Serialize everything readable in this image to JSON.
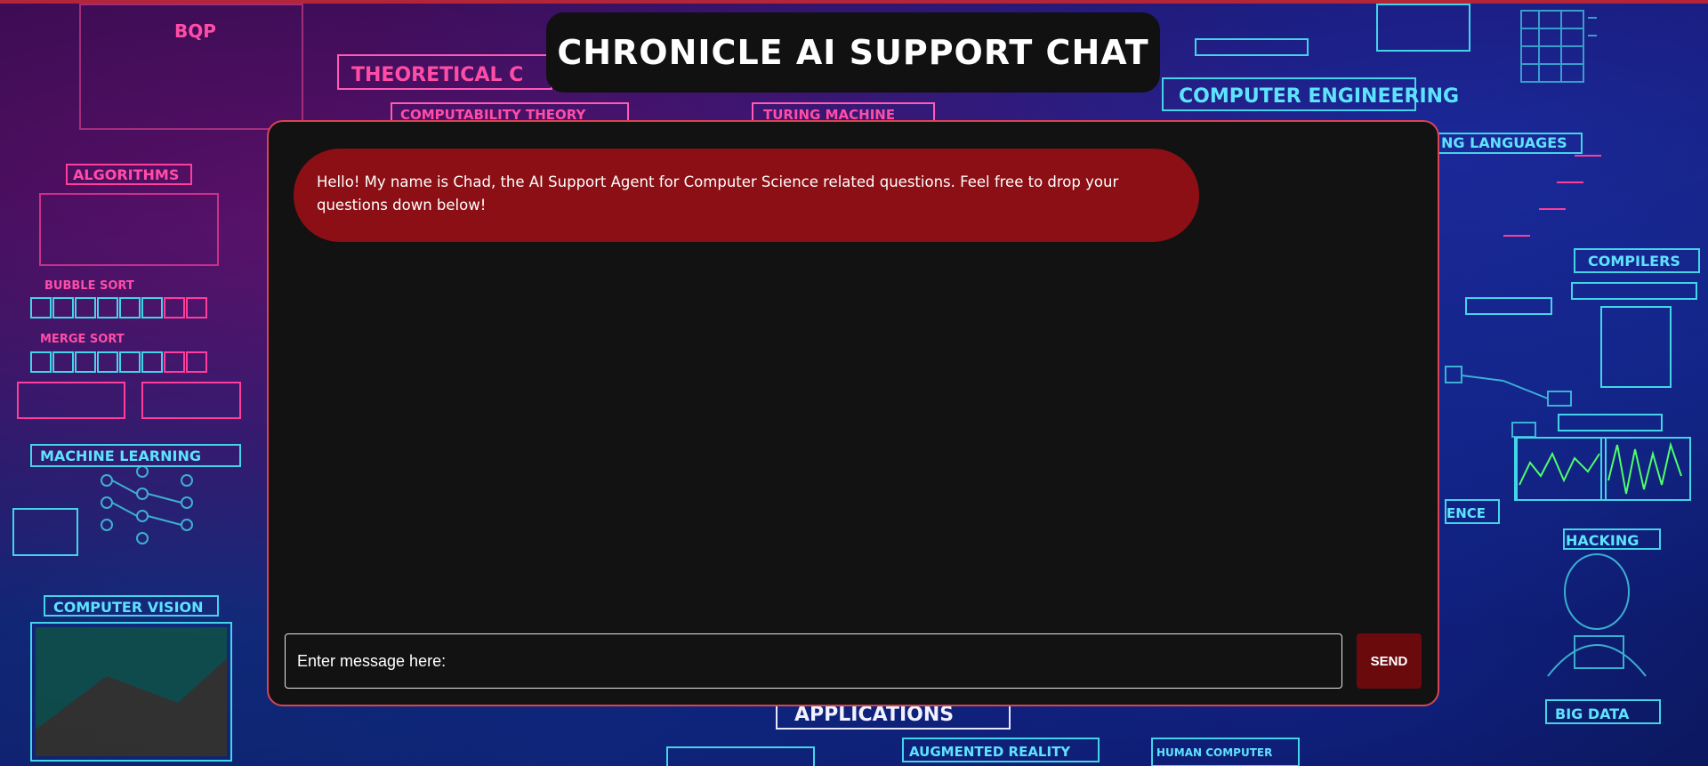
{
  "header": {
    "title": "CHRONICLE AI SUPPORT CHAT"
  },
  "chat": {
    "messages": [
      {
        "sender": "bot",
        "text": "Hello! My name is Chad, the AI Support Agent for Computer Science related questions. Feel free to drop your questions down below!"
      }
    ],
    "input": {
      "placeholder": "Enter message here:",
      "value": ""
    },
    "send_label": "SEND"
  },
  "colors": {
    "accent_border": "#d94452",
    "bot_bubble": "#8b0f14",
    "send_button": "#6b0a0d",
    "panel_background": "#121212"
  }
}
